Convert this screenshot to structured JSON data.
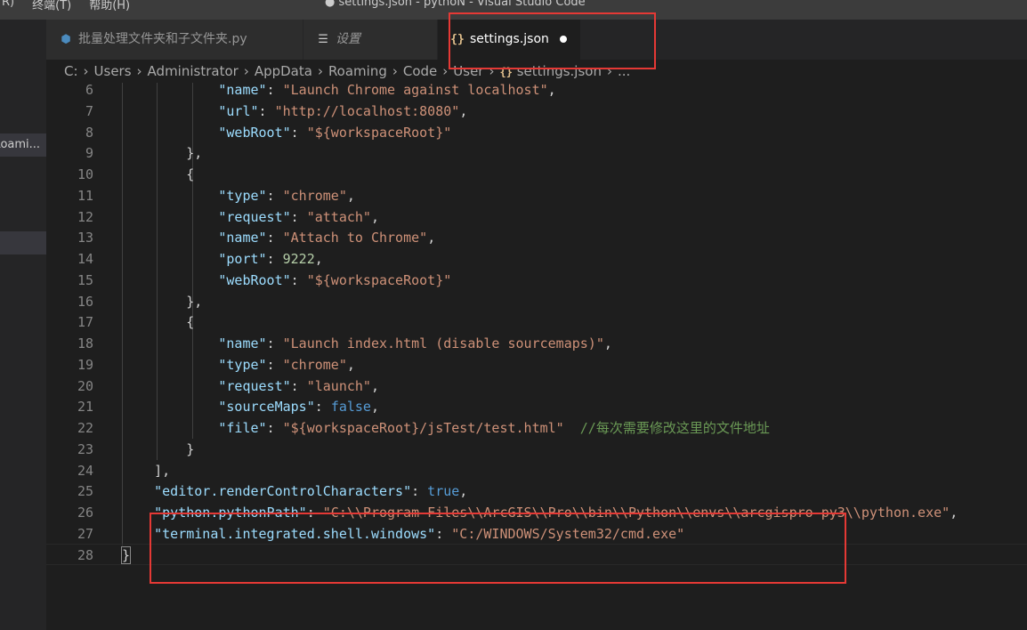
{
  "titlebar": {
    "menu": [
      "R)",
      "终端(T)",
      "帮助(H)"
    ],
    "window_title": "● settings.json - pythoN - Visual Studio Code"
  },
  "sidebar": {
    "items": [
      "Roami..."
    ]
  },
  "tabs": [
    {
      "label": "批量处理文件夹和子文件夹.py",
      "icon": "python-icon"
    },
    {
      "label": "设置",
      "icon": "list-icon"
    },
    {
      "label": "settings.json",
      "icon": "json-icon",
      "dirty": true
    }
  ],
  "breadcrumb": [
    "C:",
    "Users",
    "Administrator",
    "AppData",
    "Roaming",
    "Code",
    "User",
    "settings.json",
    "..."
  ],
  "editor": {
    "lines": [
      {
        "n": "6"
      },
      {
        "n": "7"
      },
      {
        "n": "8"
      },
      {
        "n": "9"
      },
      {
        "n": "10"
      },
      {
        "n": "11"
      },
      {
        "n": "12"
      },
      {
        "n": "13"
      },
      {
        "n": "14"
      },
      {
        "n": "15"
      },
      {
        "n": "16"
      },
      {
        "n": "17"
      },
      {
        "n": "18"
      },
      {
        "n": "19"
      },
      {
        "n": "20"
      },
      {
        "n": "21"
      },
      {
        "n": "22"
      },
      {
        "n": "23"
      },
      {
        "n": "24"
      },
      {
        "n": "25"
      },
      {
        "n": "26"
      },
      {
        "n": "27"
      },
      {
        "n": "28"
      }
    ],
    "tokens": {
      "k_name": "\"name\"",
      "k_url": "\"url\"",
      "k_webroot": "\"webRoot\"",
      "k_type": "\"type\"",
      "k_request": "\"request\"",
      "k_port": "\"port\"",
      "k_sourcemaps": "\"sourceMaps\"",
      "k_file": "\"file\"",
      "v_launch_chrome": "\"Launch Chrome against localhost\"",
      "v_url": "\"http://localhost:8080\"",
      "v_webroot": "\"${workspaceRoot}\"",
      "v_chrome": "\"chrome\"",
      "v_attach": "\"attach\"",
      "v_attach_chrome": "\"Attach to Chrome\"",
      "v_port": "9222",
      "v_launch_index": "\"Launch index.html (disable sourcemaps)\"",
      "v_launch": "\"launch\"",
      "v_false": "false",
      "v_file": "\"${workspaceRoot}/jsTest/test.html\"",
      "comment": "//每次需要修改这里的文件地址",
      "k_render": "\"editor.renderControlCharacters\"",
      "v_true": "true",
      "k_pythonpath": "\"python.pythonPath\"",
      "v_pythonpath": "\"C:\\\\Program Files\\\\ArcGIS\\\\Pro\\\\bin\\\\Python\\\\envs\\\\arcgispro-py3\\\\python.exe\"",
      "k_shell": "\"terminal.integrated.shell.windows\"",
      "v_shell": "\"C:/WINDOWS/System32/cmd.exe\""
    }
  },
  "colors": {
    "key": "#9cdcfe",
    "string": "#ce9178",
    "number": "#b5cea8",
    "boolean": "#569cd6",
    "comment": "#6a9955",
    "highlight_box": "#e53935"
  }
}
